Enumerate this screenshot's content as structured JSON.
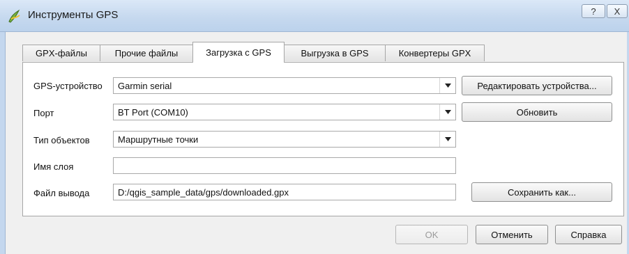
{
  "window": {
    "title": "Инструменты GPS",
    "help_label": "?",
    "close_label": "X",
    "accent": "#c6d9ef"
  },
  "tabs": [
    {
      "label": "GPX-файлы",
      "active": false
    },
    {
      "label": "Прочие файлы",
      "active": false
    },
    {
      "label": "Загрузка с GPS",
      "active": true
    },
    {
      "label": "Выгрузка в GPS",
      "active": false
    },
    {
      "label": "Конвертеры GPX",
      "active": false
    }
  ],
  "form": {
    "device_label": "GPS-устройство",
    "device_value": "Garmin serial",
    "edit_devices_label": "Редактировать устройства...",
    "port_label": "Порт",
    "port_value": "BT Port (COM10)",
    "refresh_label": "Обновить",
    "feature_type_label": "Тип объектов",
    "feature_type_value": "Маршрутные точки",
    "layer_name_label": "Имя слоя",
    "layer_name_value": "",
    "output_file_label": "Файл вывода",
    "output_file_value": "D:/qgis_sample_data/gps/downloaded.gpx",
    "save_as_label": "Сохранить как..."
  },
  "buttons": {
    "ok_label": "OK",
    "ok_enabled": false,
    "cancel_label": "Отменить",
    "help_label": "Справка"
  }
}
